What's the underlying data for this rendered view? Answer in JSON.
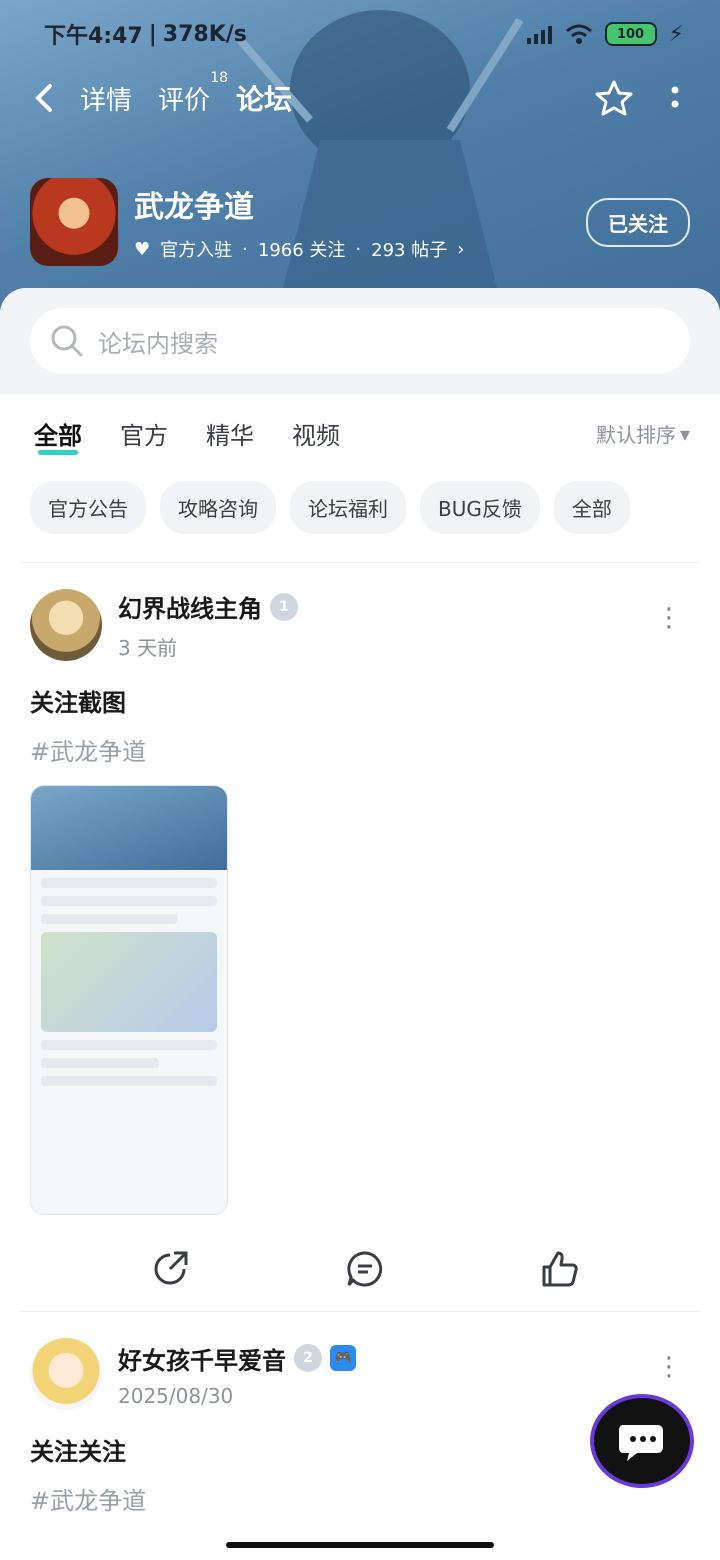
{
  "status": {
    "time": "下午4:47",
    "speed": "378K/s",
    "battery": "100"
  },
  "nav": {
    "back_icon": "chevron-left-icon",
    "tabs": [
      {
        "label": "详情"
      },
      {
        "label": "评价",
        "badge": "18"
      },
      {
        "label": "论坛"
      }
    ],
    "star_icon": "star-icon",
    "more_icon": "more-vertical-icon"
  },
  "app": {
    "title": "武龙争道",
    "official": "官方入驻",
    "followers": "1966 关注",
    "posts": "293 帖子",
    "follow_button": "已关注"
  },
  "search": {
    "placeholder": "论坛内搜索"
  },
  "tabs": [
    "全部",
    "官方",
    "精华",
    "视频"
  ],
  "sort_label": "默认排序",
  "chips": [
    "官方公告",
    "攻略咨询",
    "论坛福利",
    "BUG反馈",
    "全部"
  ],
  "posts": [
    {
      "user": "幻界战线主角",
      "level": "1",
      "time": "3 天前",
      "title": "关注截图",
      "tag": "#武龙争道"
    },
    {
      "user": "好女孩千早爱音",
      "level": "2",
      "time": "2025/08/30",
      "title": "关注关注",
      "tag": "#武龙争道"
    }
  ],
  "colors": {
    "accent": "#2fd1c1",
    "fab_ring": "#6a3ad8"
  }
}
